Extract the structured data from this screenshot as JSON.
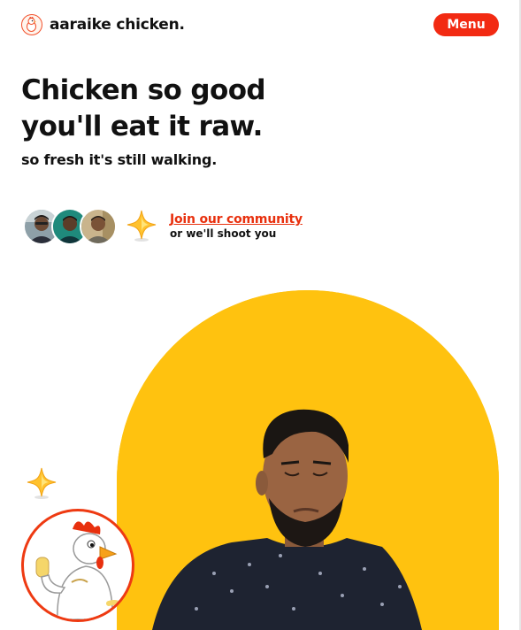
{
  "brand": {
    "name": "aaraike chicken.",
    "logo_icon": "chicken-logo-icon",
    "accent_color": "#f22a12"
  },
  "header": {
    "menu_label": "Menu"
  },
  "hero": {
    "headline_line1": "Chicken so good",
    "headline_line2": "you'll eat it raw.",
    "subtitle": "so fresh it's still walking.",
    "arch_color": "#ffc20f"
  },
  "community": {
    "avatars": [
      "avatar-person-1",
      "avatar-person-2",
      "avatar-person-3"
    ],
    "sparkle_icon": "sparkle-icon",
    "link_label": "Join our community",
    "note": "or we'll shoot you"
  },
  "mascot": {
    "icon": "chicken-mascot-thumbs-up"
  }
}
